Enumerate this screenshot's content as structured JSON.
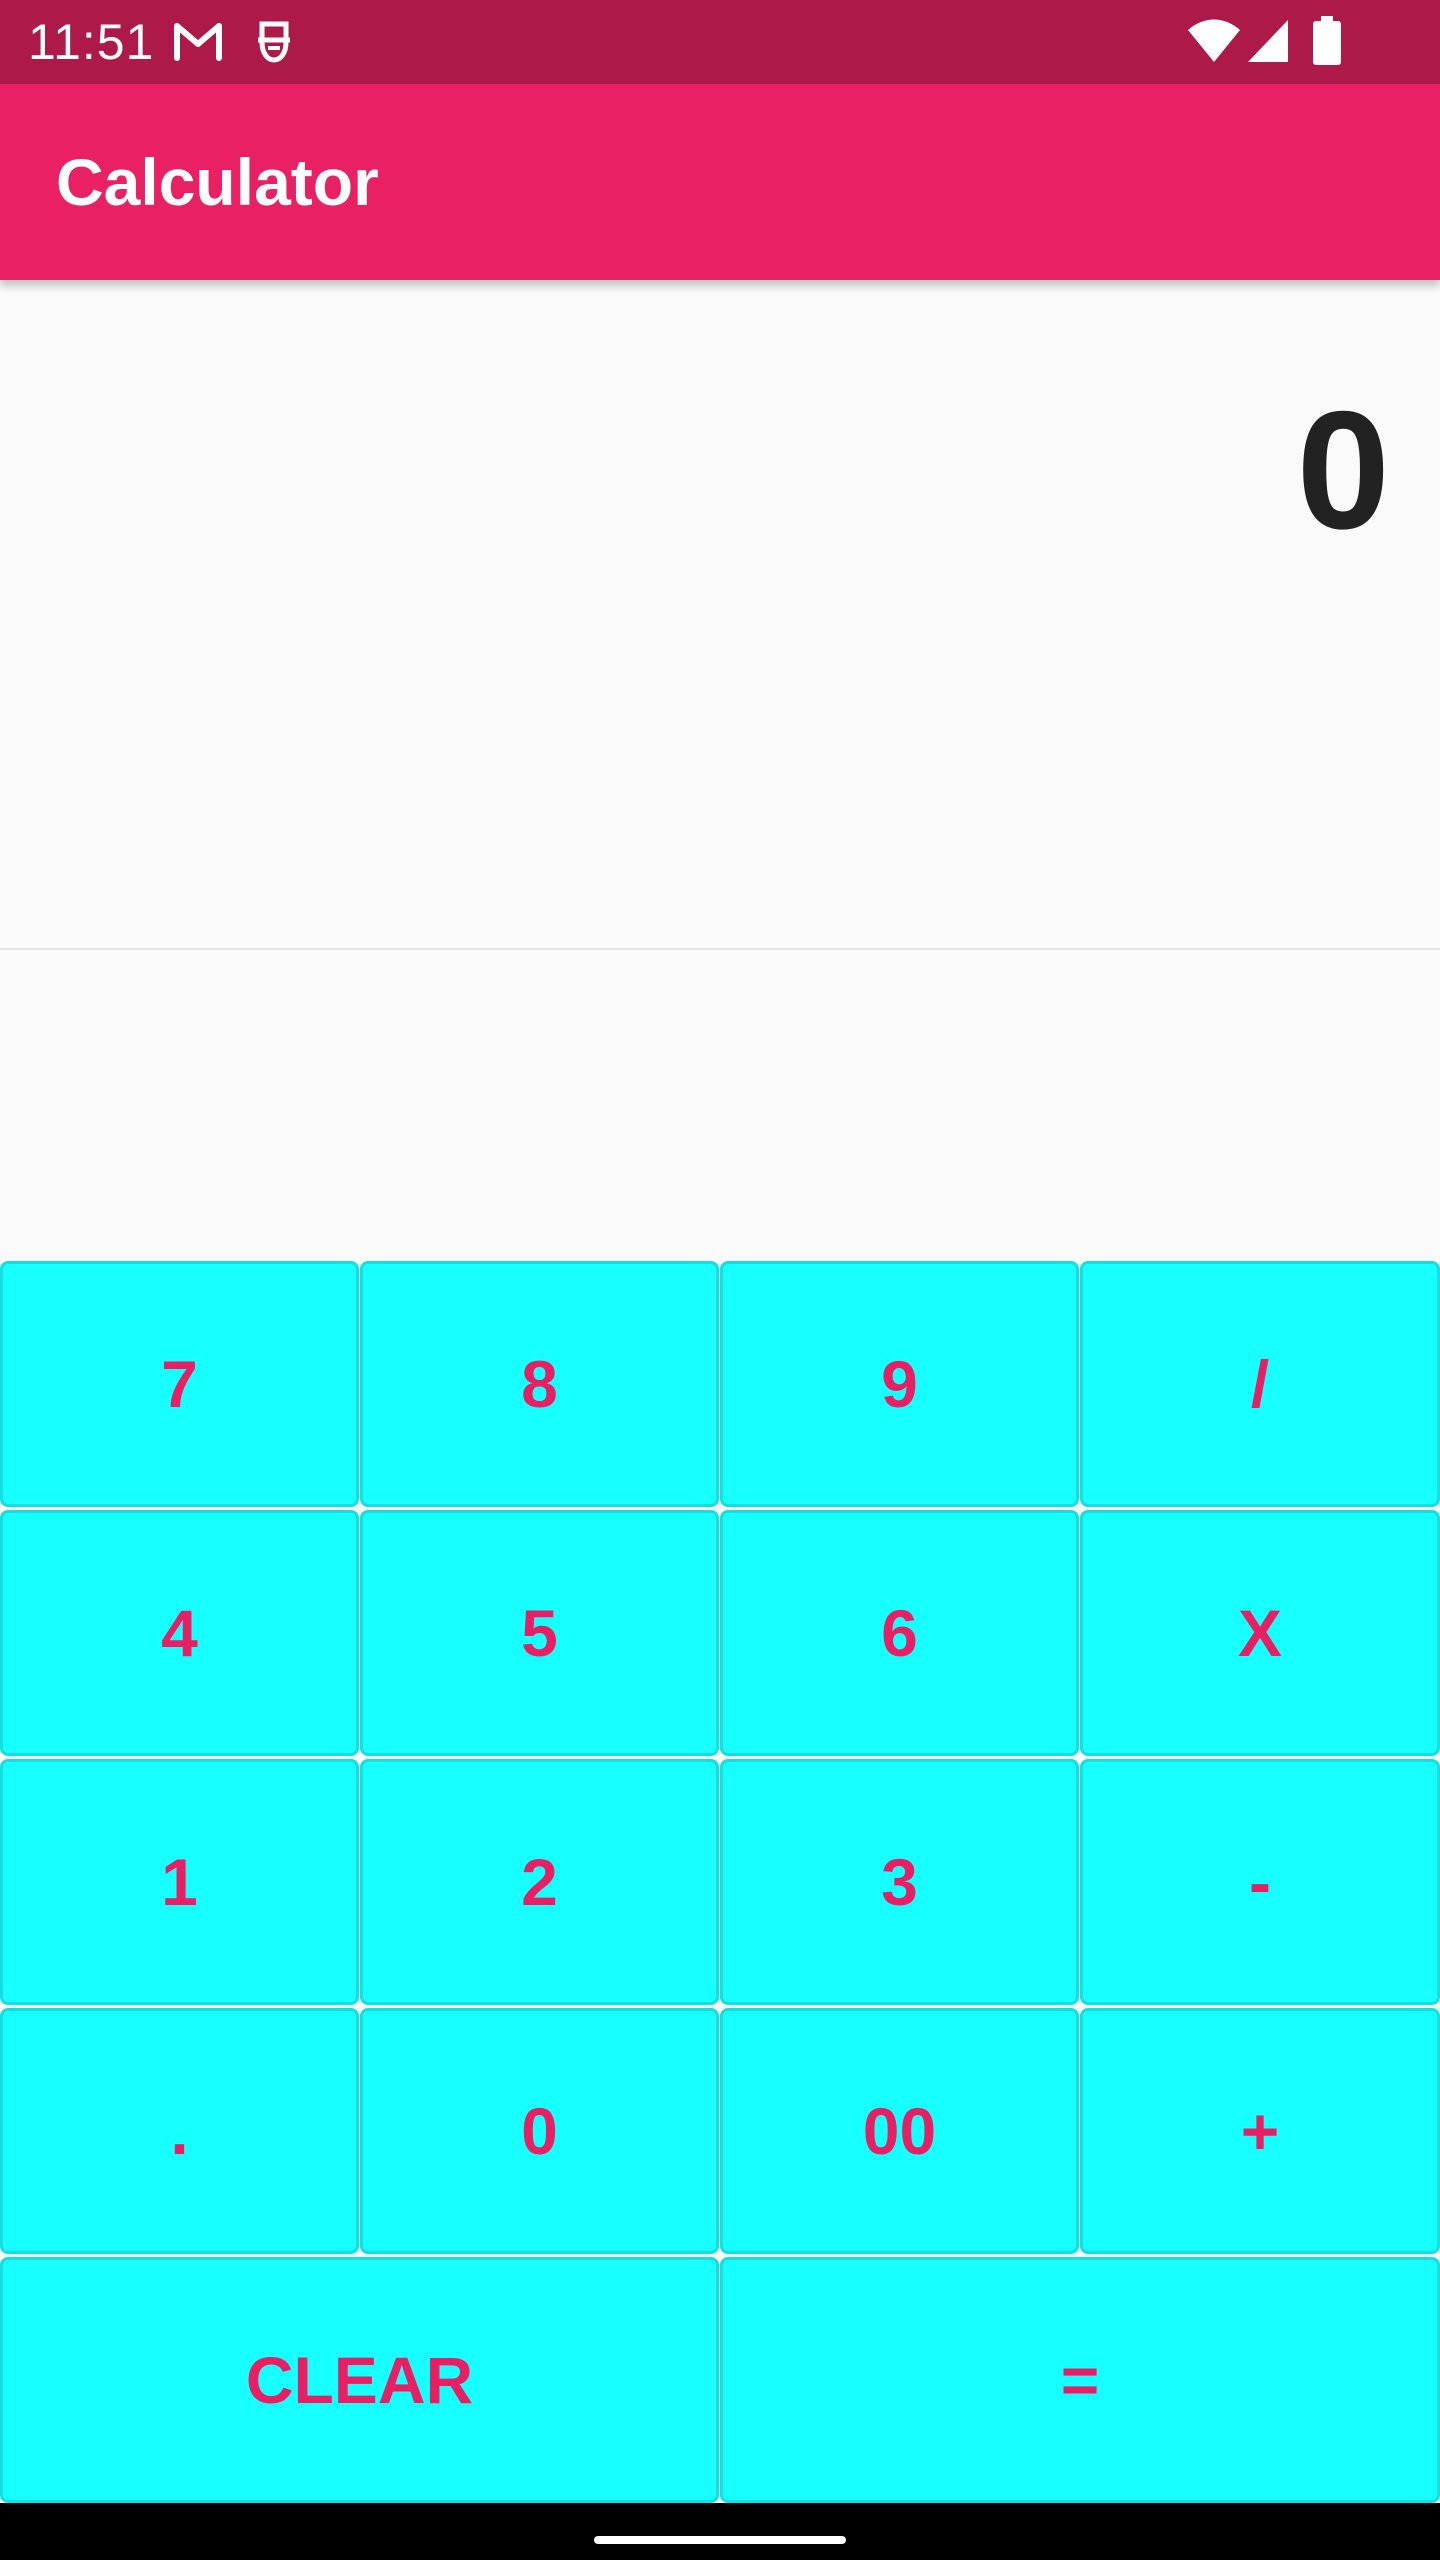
{
  "status_bar": {
    "time": "11:51",
    "left_icons": [
      "gmail-icon",
      "notification-app-icon"
    ],
    "right_icons": [
      "wifi-icon",
      "cellular-signal-icon",
      "battery-icon"
    ],
    "background": "#ad1a4a"
  },
  "app_bar": {
    "title": "Calculator",
    "background": "#ea2064"
  },
  "display": {
    "value": "0"
  },
  "keypad": {
    "key_color": "#18ffff",
    "label_color": "#e91e63",
    "keys": {
      "k7": "7",
      "k8": "8",
      "k9": "9",
      "divide": "/",
      "k4": "4",
      "k5": "5",
      "k6": "6",
      "multiply": "X",
      "k1": "1",
      "k2": "2",
      "k3": "3",
      "subtract": "-",
      "decimal": ".",
      "k0": "0",
      "k00": "00",
      "add": "+",
      "clear": "CLEAR",
      "equals": "="
    }
  }
}
